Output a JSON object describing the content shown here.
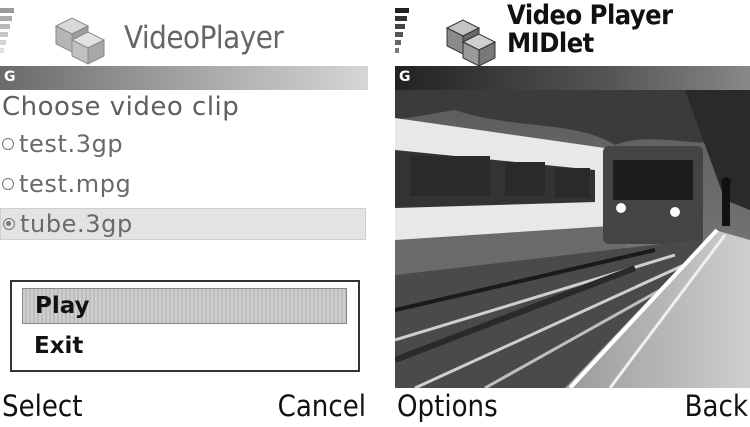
{
  "left_screen": {
    "network": "G",
    "title": "VideoPlayer",
    "heading": "Choose video clip",
    "clips": [
      {
        "label": "test.3gp",
        "selected": false
      },
      {
        "label": "test.mpg",
        "selected": false
      },
      {
        "label": "tube.3gp",
        "selected": true
      }
    ],
    "menu": [
      {
        "label": "Play",
        "highlighted": true
      },
      {
        "label": "Exit",
        "highlighted": false
      }
    ],
    "softkeys": {
      "left": "Select",
      "right": "Cancel"
    }
  },
  "right_screen": {
    "network": "G",
    "title_line1": "Video Player",
    "title_line2": "MIDlet",
    "softkeys": {
      "left": "Options",
      "right": "Back"
    }
  },
  "icons": [
    "signal-strength-icon",
    "app-cubes-icon"
  ],
  "colors": {
    "title_grey": "#666666",
    "band_dark": "#6a6a6a",
    "band_light": "#d6d6d6"
  }
}
